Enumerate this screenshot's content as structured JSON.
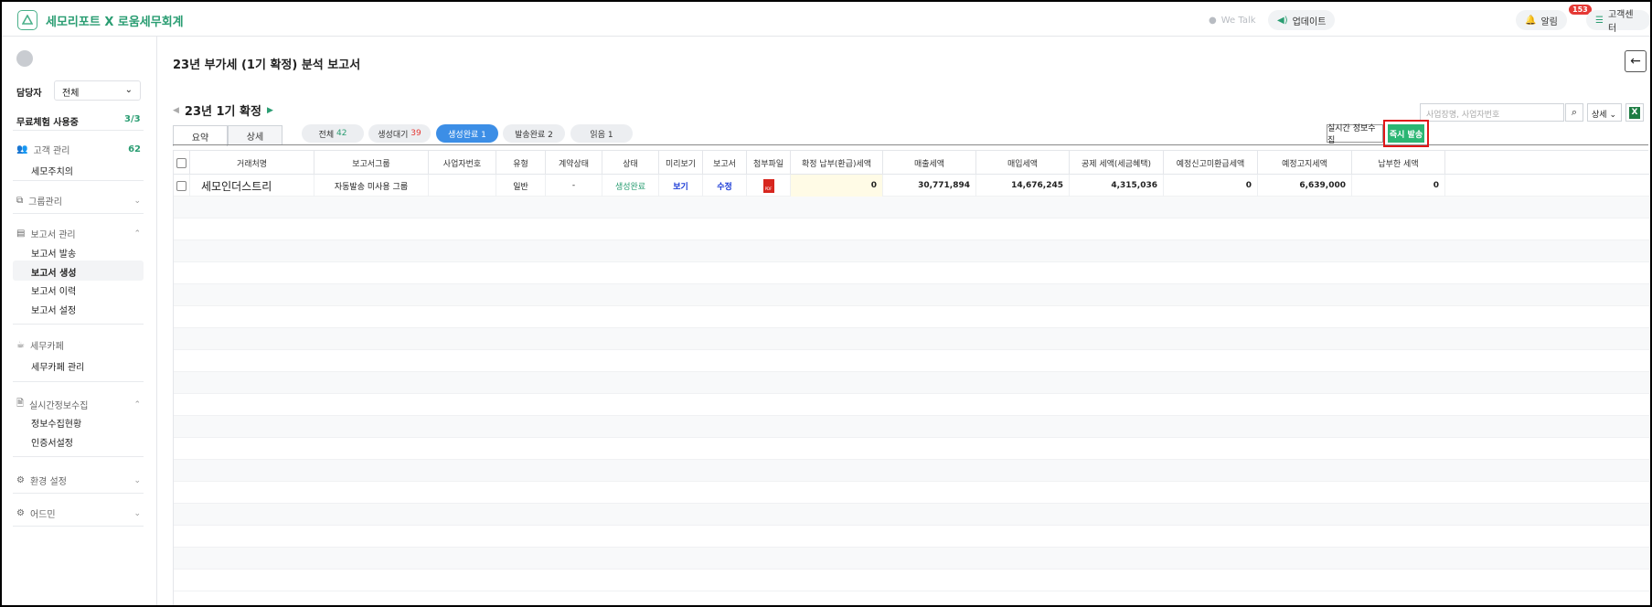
{
  "topbar": {
    "brand": "세모리포트 X 로움세무회계",
    "wetalk": "We Talk",
    "update": "업데이트",
    "alarm": "알림",
    "alarm_count": "153",
    "support": "고객센터"
  },
  "sidebar": {
    "manager_label": "담당자",
    "manager_value": "전체",
    "trial_label": "무료체험 사용중",
    "trial_value": "3/3",
    "client_mgmt": "고객 관리",
    "client_count": "62",
    "client_tax_notes": "세모주치의",
    "group_mgmt": "그룹관리",
    "report_mgmt": "보고서 관리",
    "report_send": "보고서 발송",
    "report_create": "보고서 생성",
    "report_history": "보고서 이력",
    "report_settings": "보고서 설정",
    "tax_cafe": "세무카페",
    "tax_cafe_mgmt": "세무카페 관리",
    "realtime": "실시간정보수집",
    "realtime_status": "정보수집현황",
    "cert_settings": "인증서설정",
    "env_settings": "환경 설정",
    "admin": "어드민"
  },
  "main": {
    "title": "23년 부가세 (1기 확정) 분석 보고서",
    "period": "23년 1기 확정",
    "search_placeholder": "사업장명, 사업자번호",
    "detail_select": "상세",
    "excel_icon": "X",
    "tab_summary": "요약",
    "tab_detail": "상세",
    "chip_all": "전체",
    "chip_all_count": "42",
    "chip_waiting": "생성대기",
    "chip_waiting_count": "39",
    "chip_done": "생성완료 1",
    "chip_sent": "발송완료 2",
    "chip_read": "읽음 1",
    "realtime_btn": "실시간 정보수집",
    "send_now_btn": "즉시 발송"
  },
  "table": {
    "headers": [
      "거래처명",
      "보고서그룹",
      "사업자번호",
      "유형",
      "계약상태",
      "상태",
      "미리보기",
      "보고서",
      "첨부파일",
      "확정 납부(환급)세액",
      "매출세액",
      "매입세액",
      "공제 세액(세금혜택)",
      "예정신고미환급세액",
      "예정고지세액",
      "납부한 세액"
    ],
    "rows": [
      [
        "세모인더스트리",
        "자동발송 미사용 그룹",
        "",
        "일반",
        "-",
        "생성완료",
        "보기",
        "수정",
        "PDF",
        "0",
        "30,771,894",
        "14,676,245",
        "4,315,036",
        "0",
        "6,639,000",
        "0"
      ]
    ]
  }
}
